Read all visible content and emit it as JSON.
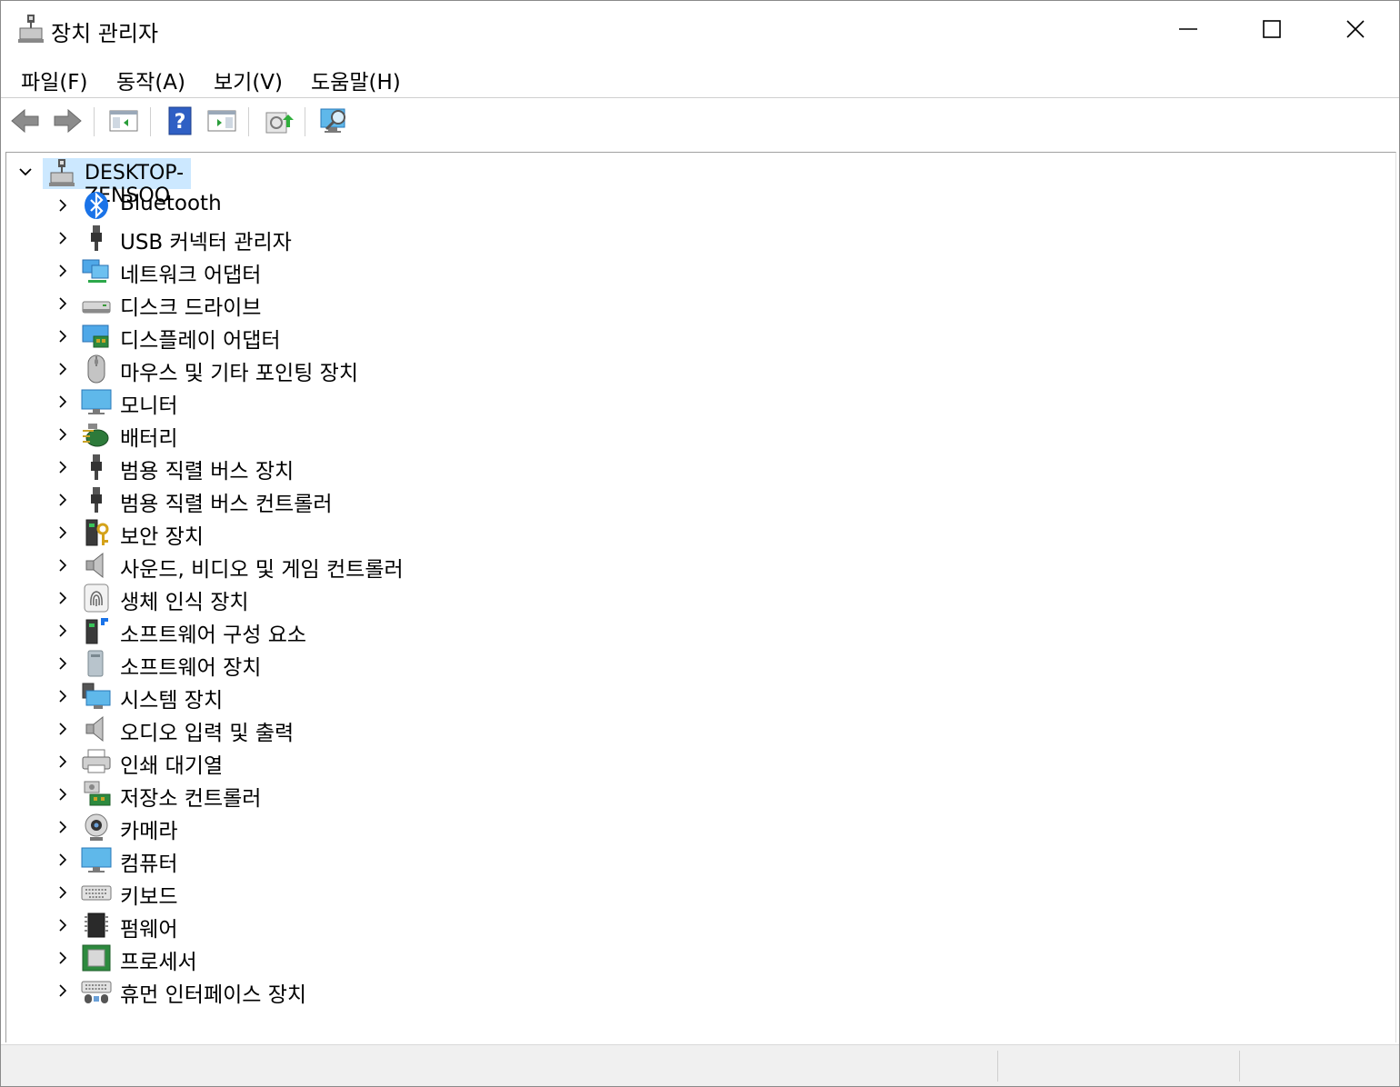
{
  "window": {
    "title": "장치 관리자"
  },
  "menu": [
    "파일(F)",
    "동작(A)",
    "보기(V)",
    "도움말(H)"
  ],
  "toolbar": [
    "back-icon",
    "forward-icon",
    "show-hide-console-tree-icon",
    "help-icon",
    "action-pane-icon",
    "update-driver-icon",
    "scan-hardware-icon"
  ],
  "tree": {
    "root": "DESKTOP-ZENSOO",
    "categories": [
      {
        "label": "Bluetooth",
        "icon": "bluetooth-icon"
      },
      {
        "label": "USB 커넥터 관리자",
        "icon": "usb-connector-icon"
      },
      {
        "label": "네트워크 어댑터",
        "icon": "network-adapter-icon"
      },
      {
        "label": "디스크 드라이브",
        "icon": "disk-drive-icon"
      },
      {
        "label": "디스플레이 어댑터",
        "icon": "display-adapter-icon"
      },
      {
        "label": "마우스 및 기타 포인팅 장치",
        "icon": "mouse-icon"
      },
      {
        "label": "모니터",
        "icon": "monitor-icon"
      },
      {
        "label": "배터리",
        "icon": "battery-icon"
      },
      {
        "label": "범용 직렬 버스 장치",
        "icon": "usb-device-icon"
      },
      {
        "label": "범용 직렬 버스 컨트롤러",
        "icon": "usb-controller-icon"
      },
      {
        "label": "보안 장치",
        "icon": "security-device-icon"
      },
      {
        "label": "사운드, 비디오 및 게임 컨트롤러",
        "icon": "speaker-icon"
      },
      {
        "label": "생체 인식 장치",
        "icon": "fingerprint-icon"
      },
      {
        "label": "소프트웨어 구성 요소",
        "icon": "software-component-icon"
      },
      {
        "label": "소프트웨어 장치",
        "icon": "software-device-icon"
      },
      {
        "label": "시스템 장치",
        "icon": "system-device-icon"
      },
      {
        "label": "오디오 입력 및 출력",
        "icon": "audio-io-icon"
      },
      {
        "label": "인쇄 대기열",
        "icon": "printer-icon"
      },
      {
        "label": "저장소 컨트롤러",
        "icon": "storage-controller-icon"
      },
      {
        "label": "카메라",
        "icon": "camera-icon"
      },
      {
        "label": "컴퓨터",
        "icon": "computer-icon"
      },
      {
        "label": "키보드",
        "icon": "keyboard-icon"
      },
      {
        "label": "펌웨어",
        "icon": "firmware-icon"
      },
      {
        "label": "프로세서",
        "icon": "processor-icon"
      },
      {
        "label": "휴먼 인터페이스 장치",
        "icon": "hid-icon"
      }
    ]
  },
  "colors": {
    "selection": "#cce8ff",
    "accent": "#0078d4"
  }
}
